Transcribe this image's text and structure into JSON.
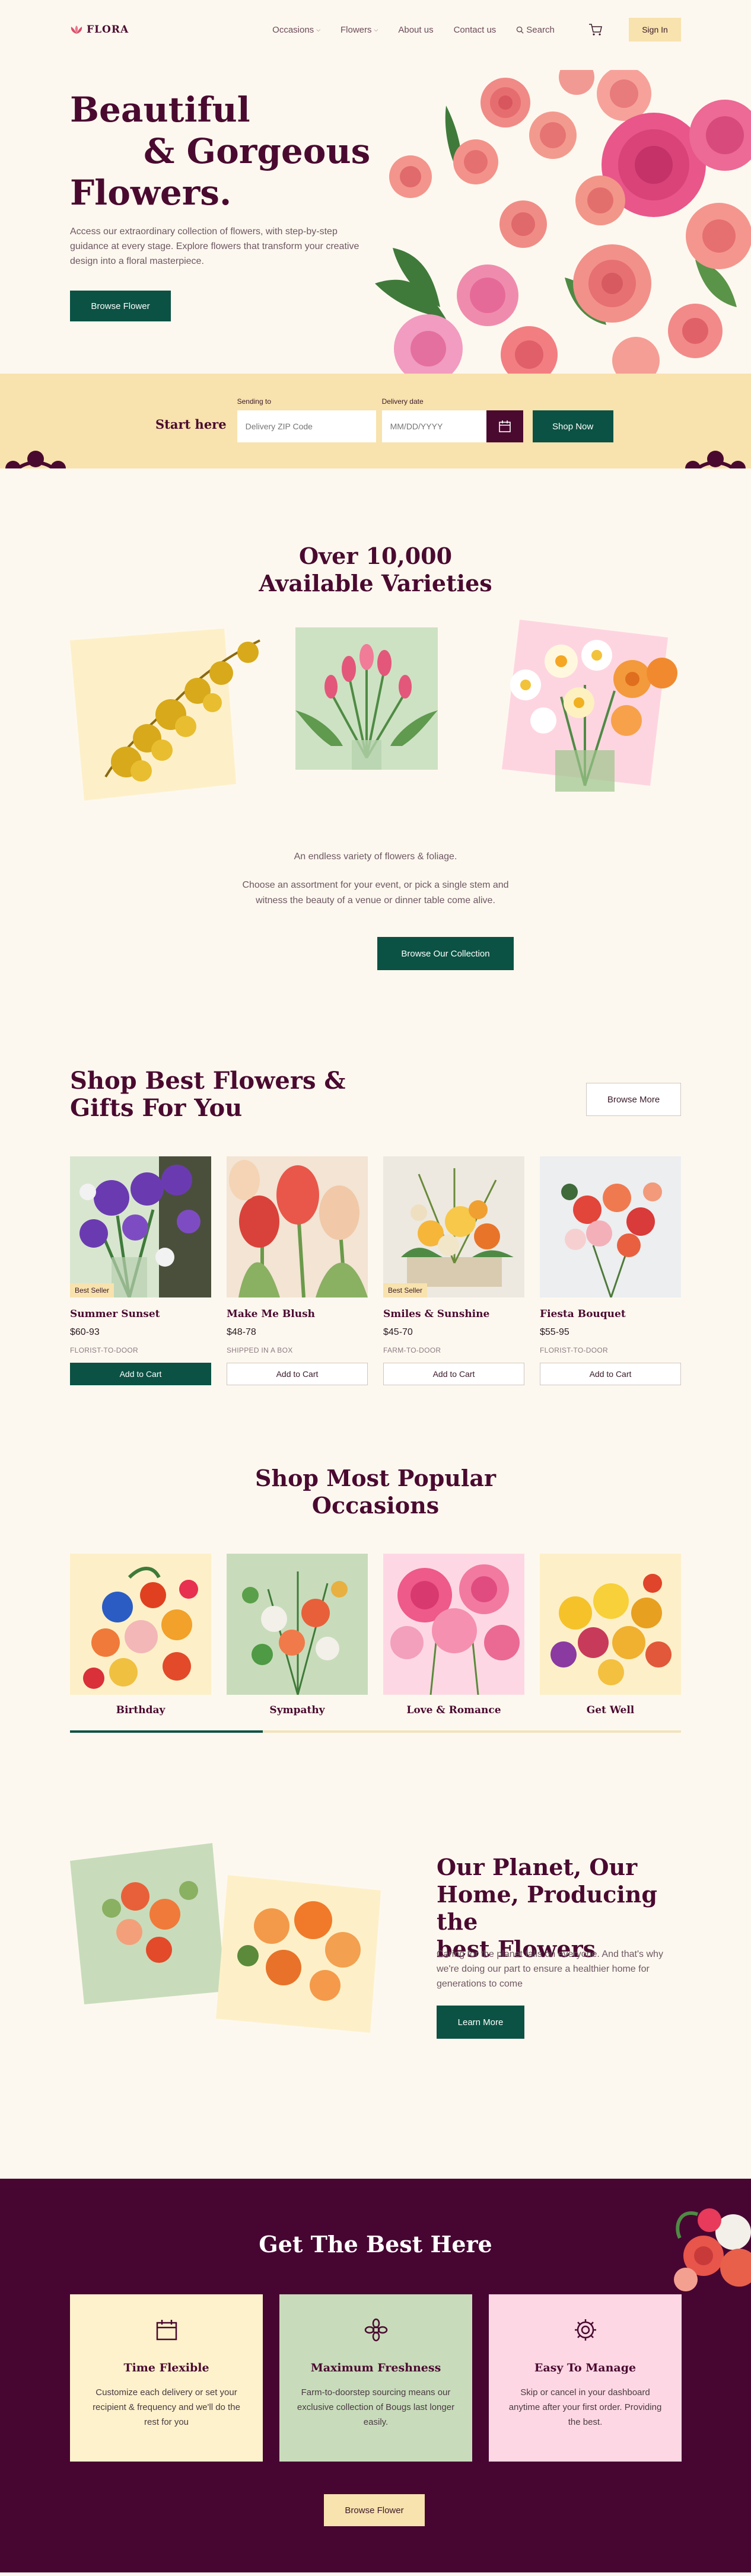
{
  "nav": {
    "logo": "FLORA",
    "links": [
      "Occasions",
      "Flowers",
      "About us",
      "Contact us"
    ],
    "search": "Search",
    "signin": "Sign In"
  },
  "hero": {
    "title_line1": "Beautiful",
    "title_line2": "& Gorgeous",
    "title_line3": "Flowers.",
    "description": "Access our extraordinary collection of flowers, with step-by-step guidance at every stage. Explore flowers that transform your creative design into a floral masterpiece.",
    "button": "Browse Flower"
  },
  "delivery": {
    "start": "Start here",
    "sending_label": "Sending to",
    "sending_placeholder": "Delivery ZIP Code",
    "date_label": "Delivery date",
    "date_placeholder": "MM/DD/YYYY",
    "button": "Shop Now"
  },
  "varieties": {
    "title_line1": "Over 10,000",
    "title_line2": "Available Varieties",
    "text1": "An endless variety of flowers & foliage.",
    "text2_line1": "Choose an assortment for your event, or pick a single stem and",
    "text2_line2": "witness the beauty of a venue or dinner table come alive.",
    "button": "Browse Our Collection"
  },
  "products": {
    "title_line1": "Shop Best Flowers &",
    "title_line2": "Gifts For You",
    "browse_more": "Browse More",
    "items": [
      {
        "name": "Summer Sunset",
        "price": "$60-93",
        "tag": "FLORIST-TO-DOOR",
        "badge": "Best Seller",
        "button": "Add to Cart"
      },
      {
        "name": "Make Me Blush",
        "price": "$48-78",
        "tag": "SHIPPED IN A BOX",
        "badge": "",
        "button": "Add to Cart"
      },
      {
        "name": "Smiles & Sunshine",
        "price": "$45-70",
        "tag": "FARM-TO-DOOR",
        "badge": "Best Seller",
        "button": "Add to Cart"
      },
      {
        "name": "Fiesta Bouquet",
        "price": "$55-95",
        "tag": "FLORIST-TO-DOOR",
        "badge": "",
        "button": "Add to Cart"
      }
    ]
  },
  "occasions": {
    "title_line1": "Shop Most Popular",
    "title_line2": "Occasions",
    "items": [
      "Birthday",
      "Sympathy",
      "Love & Romance",
      "Get Well"
    ]
  },
  "planet": {
    "title_line1": "Our Planet, Our",
    "title_line2": "Home, Producing the",
    "title_line3": "best Flowers",
    "description": "Caring for the planet falls on everyone. And that's why we're doing our part to ensure a healthier home for generations to come",
    "button": "Learn More"
  },
  "best": {
    "title": "Get The Best Here",
    "cards": [
      {
        "title": "Time Flexible",
        "text": "Customize each delivery or set your recipient & frequency and we'll do the rest for you",
        "color": "#fdf2cc"
      },
      {
        "title": "Maximum Freshness",
        "text": "Farm-to-doorstep sourcing means our exclusive collection of Bougs last longer easily.",
        "color": "#c8dcbb"
      },
      {
        "title": "Easy To Manage",
        "text": "Skip or cancel in your dashboard anytime after your first order. Providing the best.",
        "color": "#fdd8e4"
      }
    ],
    "button": "Browse Flower"
  },
  "colors": {
    "primary_green": "#0b5244",
    "plum": "#4a0a30",
    "cream": "#fdf8ef",
    "butter": "#f8e2ad"
  }
}
